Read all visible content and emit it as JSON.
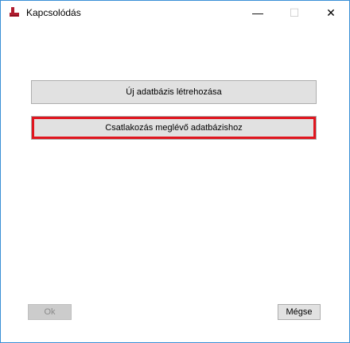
{
  "window": {
    "title": "Kapcsolódás",
    "icon": "database-app-icon",
    "controls": {
      "minimize": "—",
      "maximize": "☐",
      "close": "✕"
    }
  },
  "main": {
    "new_database_label": "Új adatbázis létrehozása",
    "connect_existing_label": "Csatlakozás meglévő adatbázishoz"
  },
  "footer": {
    "ok_label": "Ok",
    "cancel_label": "Mégse"
  },
  "colors": {
    "highlight": "#e0161f",
    "window_border": "#3a8fd6"
  }
}
